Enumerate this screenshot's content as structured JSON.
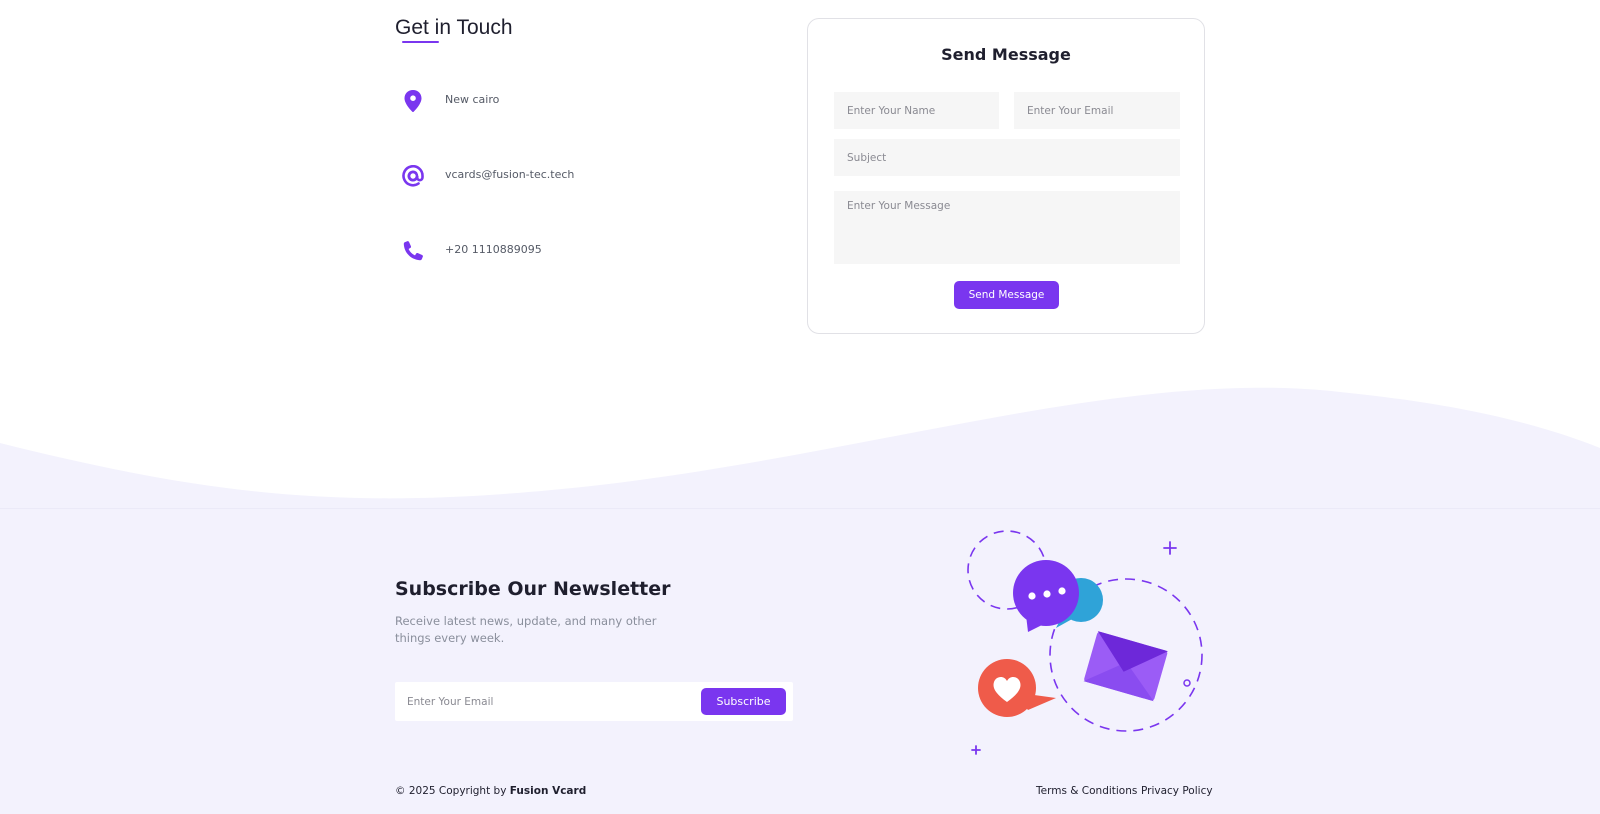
{
  "contact": {
    "title": "Get in Touch",
    "items": [
      {
        "icon": "location-pin-icon",
        "text": "New cairo"
      },
      {
        "icon": "at-sign-icon",
        "text": "vcards@fusion-tec.tech"
      },
      {
        "icon": "phone-icon",
        "text": "+20 1110889095"
      }
    ]
  },
  "form": {
    "title": "Send Message",
    "name_placeholder": "Enter Your Name",
    "email_placeholder": "Enter Your Email",
    "subject_placeholder": "Subject",
    "message_placeholder": "Enter Your Message",
    "submit_label": "Send Message"
  },
  "newsletter": {
    "title": "Subscribe Our Newsletter",
    "description": "Receive latest news, update, and many other things every week.",
    "email_placeholder": "Enter Your Email",
    "button_label": "Subscribe"
  },
  "footer": {
    "copyright_prefix": "© 2025 Copyright by",
    "brand": "Fusion Vcard",
    "links": [
      "Terms & Conditions",
      "Privacy Policy"
    ]
  },
  "colors": {
    "accent": "#7a36ef",
    "footer_bg": "#f3f2fd",
    "chat_blue": "#2fa3d8",
    "heart_red": "#ef5b4a"
  }
}
